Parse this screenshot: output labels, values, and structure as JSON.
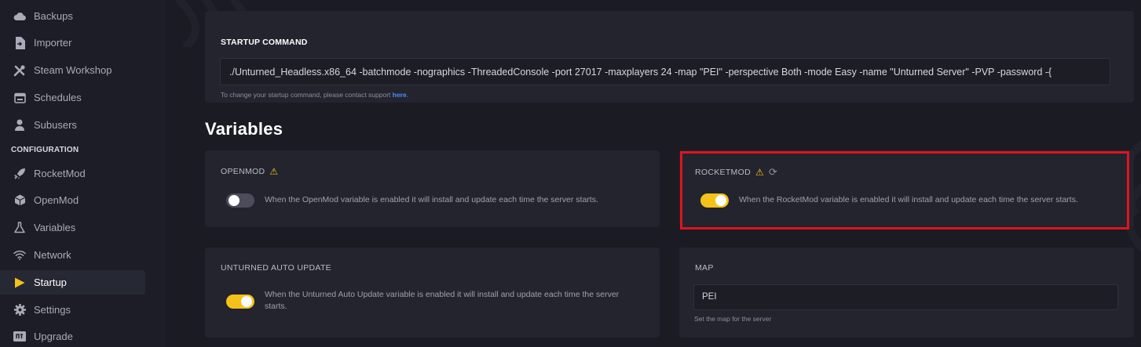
{
  "sidebar": {
    "items": [
      {
        "label": "Backups",
        "icon": "cloud-icon"
      },
      {
        "label": "Importer",
        "icon": "file-import-icon"
      },
      {
        "label": "Steam Workshop",
        "icon": "tools-icon"
      },
      {
        "label": "Schedules",
        "icon": "calendar-icon"
      },
      {
        "label": "Subusers",
        "icon": "user-icon"
      }
    ],
    "section_label": "CONFIGURATION",
    "config_items": [
      {
        "label": "RocketMod",
        "icon": "rocket-icon"
      },
      {
        "label": "OpenMod",
        "icon": "cube-icon"
      },
      {
        "label": "Variables",
        "icon": "flask-icon"
      },
      {
        "label": "Network",
        "icon": "wifi-icon"
      },
      {
        "label": "Startup",
        "icon": "play-icon"
      },
      {
        "label": "Settings",
        "icon": "gear-icon"
      },
      {
        "label": "Upgrade",
        "icon": "upgrade-icon"
      }
    ],
    "active": "Startup"
  },
  "startup": {
    "title": "STARTUP COMMAND",
    "command": "./Unturned_Headless.x86_64 -batchmode -nographics -ThreadedConsole -port 27017 -maxplayers 24 -map \"PEI\" -perspective Both -mode Easy -name \"Unturned Server\" -PVP -password -{",
    "help_prefix": "To change your startup command, please contact support ",
    "help_link": "here",
    "help_suffix": "."
  },
  "variables": {
    "heading": "Variables",
    "openmod": {
      "title": "OPENMOD",
      "enabled": false,
      "description": "When the OpenMod variable is enabled it will install and update each time the server starts."
    },
    "rocketmod": {
      "title": "ROCKETMOD",
      "enabled": true,
      "description": "When the RocketMod variable is enabled it will install and update each time the server starts."
    },
    "auto_update": {
      "title": "UNTURNED AUTO UPDATE",
      "enabled": true,
      "description": "When the Unturned Auto Update variable is enabled it will install and update each time the server starts."
    },
    "map": {
      "title": "MAP",
      "value": "PEI",
      "help": "Set the map for the server"
    }
  },
  "colors": {
    "accent_toggle": "#f4c21b",
    "warning": "#f5c518",
    "link": "#4c8dff",
    "highlight_border": "#e0141f"
  }
}
